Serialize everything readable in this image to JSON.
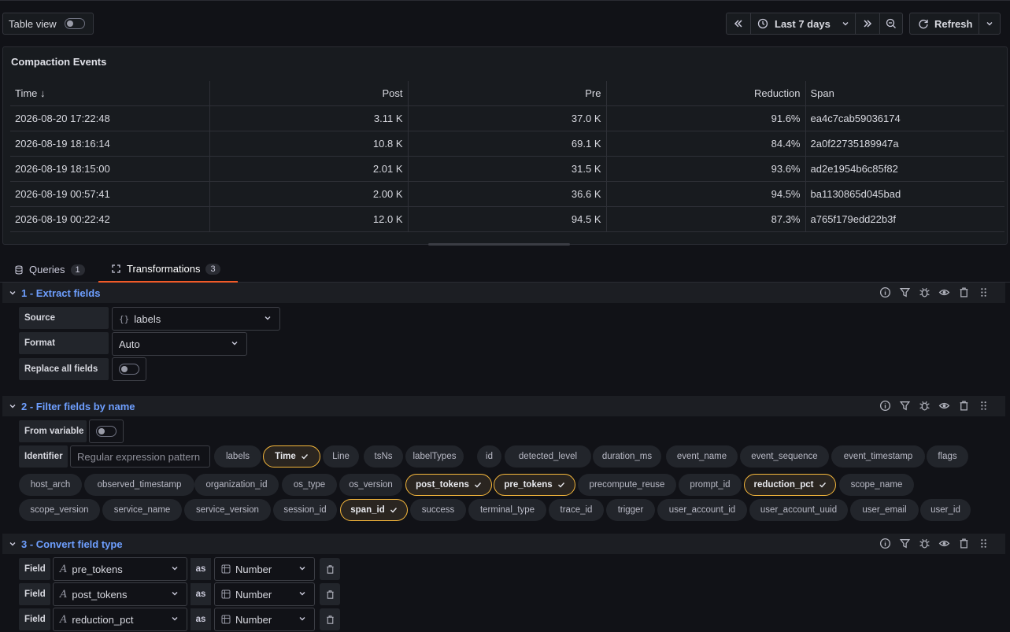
{
  "toolbar": {
    "table_view_label": "Table view",
    "time_range": "Last 7 days",
    "refresh_label": "Refresh"
  },
  "panel": {
    "title": "Compaction Events",
    "columns": [
      "Time",
      "Post",
      "Pre",
      "Reduction",
      "Span"
    ],
    "sort_indicator": "↓",
    "rows": [
      [
        "2026-08-20 17:22:48",
        "3.11 K",
        "37.0 K",
        "91.6%",
        "ea4c7cab59036174"
      ],
      [
        "2026-08-19 18:16:14",
        "10.8 K",
        "69.1 K",
        "84.4%",
        "2a0f22735189947a"
      ],
      [
        "2026-08-19 18:15:00",
        "2.01 K",
        "31.5 K",
        "93.6%",
        "ad2e1954b6c85f82"
      ],
      [
        "2026-08-19 00:57:41",
        "2.00 K",
        "36.6 K",
        "94.5%",
        "ba1130865d045bad"
      ],
      [
        "2026-08-19 00:22:42",
        "12.0 K",
        "94.5 K",
        "87.3%",
        "a765f179edd22b3f"
      ]
    ]
  },
  "tabs": {
    "queries": {
      "label": "Queries",
      "count": "1"
    },
    "transformations": {
      "label": "Transformations",
      "count": "3"
    }
  },
  "t1": {
    "title": "1 - Extract fields",
    "source_label": "Source",
    "source_value": "labels",
    "source_icon": "{}",
    "format_label": "Format",
    "format_value": "Auto",
    "replace_label": "Replace all fields"
  },
  "t2": {
    "title": "2 - Filter fields by name",
    "from_variable_label": "From variable",
    "identifier_label": "Identifier",
    "identifier_placeholder": "Regular expression pattern",
    "chips_row1": [
      {
        "label": "labels",
        "on": false
      },
      {
        "label": "Time",
        "on": true
      },
      {
        "label": "Line",
        "on": false
      },
      {
        "label": "tsNs",
        "on": false
      },
      {
        "label": "labelTypes",
        "on": false
      },
      {
        "label": "id",
        "on": false
      },
      {
        "label": "detected_level",
        "on": false
      },
      {
        "label": "duration_ms",
        "on": false
      },
      {
        "label": "event_name",
        "on": false
      },
      {
        "label": "event_sequence",
        "on": false
      },
      {
        "label": "event_timestamp",
        "on": false
      },
      {
        "label": "flags",
        "on": false
      }
    ],
    "chips_row2": [
      {
        "label": "host_arch",
        "on": false
      },
      {
        "label": "observed_timestamp",
        "on": false
      },
      {
        "label": "organization_id",
        "on": false
      },
      {
        "label": "os_type",
        "on": false
      },
      {
        "label": "os_version",
        "on": false
      },
      {
        "label": "post_tokens",
        "on": true
      },
      {
        "label": "pre_tokens",
        "on": true
      },
      {
        "label": "precompute_reuse",
        "on": false
      },
      {
        "label": "prompt_id",
        "on": false
      },
      {
        "label": "reduction_pct",
        "on": true
      },
      {
        "label": "scope_name",
        "on": false
      }
    ],
    "chips_row3": [
      {
        "label": "scope_version",
        "on": false
      },
      {
        "label": "service_name",
        "on": false
      },
      {
        "label": "service_version",
        "on": false
      },
      {
        "label": "session_id",
        "on": false
      },
      {
        "label": "span_id",
        "on": true
      },
      {
        "label": "success",
        "on": false
      },
      {
        "label": "terminal_type",
        "on": false
      },
      {
        "label": "trace_id",
        "on": false
      },
      {
        "label": "trigger",
        "on": false
      },
      {
        "label": "user_account_id",
        "on": false
      },
      {
        "label": "user_account_uuid",
        "on": false
      },
      {
        "label": "user_email",
        "on": false
      },
      {
        "label": "user_id",
        "on": false
      }
    ]
  },
  "t3": {
    "title": "3 - Convert field type",
    "field_label": "Field",
    "as_label": "as",
    "rows": [
      {
        "field": "pre_tokens",
        "type": "Number"
      },
      {
        "field": "post_tokens",
        "type": "Number"
      },
      {
        "field": "reduction_pct",
        "type": "Number"
      }
    ]
  },
  "colors": {
    "accent": "#6e9fff",
    "selected_border": "#f5b73b",
    "tab_underline": "#f05a28"
  }
}
